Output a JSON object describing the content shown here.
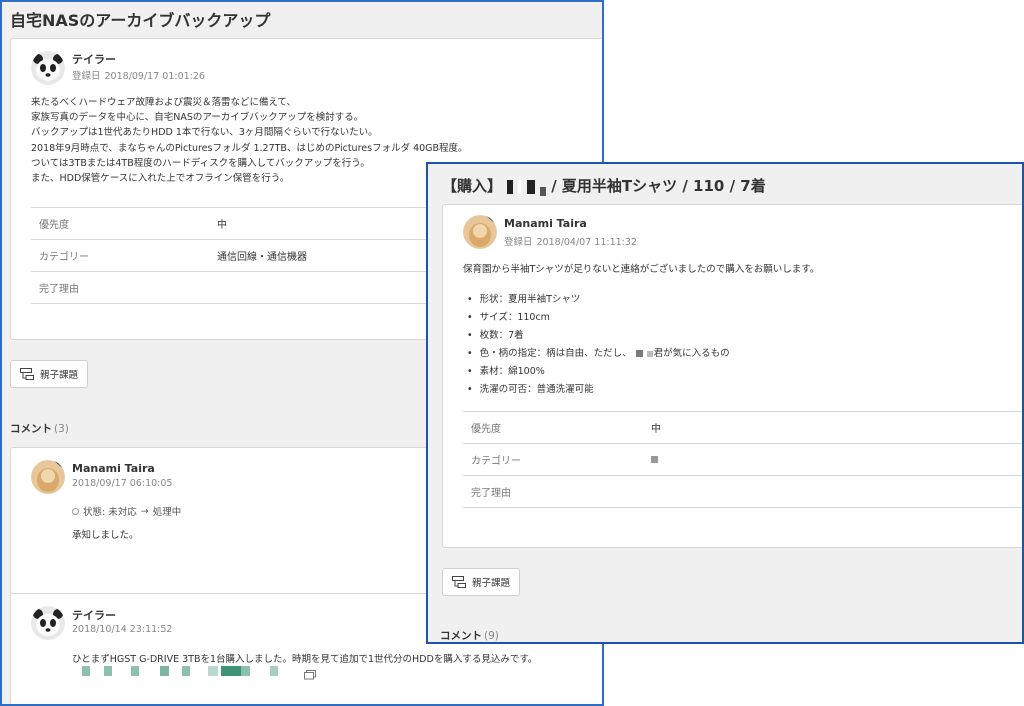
{
  "window_a": {
    "title": "自宅NASのアーカイブバックアップ",
    "issue": {
      "author": "テイラー",
      "created_label": "登録日",
      "created_at": "2018/09/17 01:01:26",
      "description": [
        "来たるべくハードウェア故障および震災＆落雷などに備えて、",
        "家族写真のデータを中心に、自宅NASのアーカイブバックアップを検討する。",
        "バックアップは1世代あたりHDD 1本で行ない、3ヶ月間隔ぐらいで行ないたい。",
        "2018年9月時点で、まなちゃんのPicturesフォルダ 1.27TB、はじめのPicturesフォルダ 40GB程度。",
        "ついては3TBまたは4TB程度のハードディスクを購入してバックアップを行う。",
        "また、HDD保管ケースに入れた上でオフライン保管を行う。"
      ],
      "properties": [
        {
          "key": "優先度",
          "value": "中"
        },
        {
          "key": "カテゴリー",
          "value": "通信回線・通信機器"
        },
        {
          "key": "完了理由",
          "value": ""
        }
      ]
    },
    "parent_child_button": "親子課題",
    "comments_label": "コメント",
    "comments_count": "(3)",
    "comments": [
      {
        "author": "Manami Taira",
        "date": "2018/09/17 06:10:05",
        "status_label": "状態: 未対応",
        "status_arrow": "→",
        "status_to": "処理中",
        "text": "承知しました。"
      },
      {
        "author": "テイラー",
        "date": "2018/10/14 23:11:52",
        "text": "ひとまずHGST G-DRIVE 3TBを1台購入しました。時期を見て追加で1世代分のHDDを購入する見込みです。"
      }
    ]
  },
  "window_b": {
    "title_prefix": "【購入】",
    "title_suffix": "/ 夏用半袖Tシャツ / 110 / 7着",
    "issue": {
      "author": "Manami Taira",
      "created_label": "登録日",
      "created_at": "2018/04/07 11:11:32",
      "intro": "保育園から半袖Tシャツが足りないと連絡がございましたので購入をお願いします。",
      "bullets": [
        "形状：夏用半袖Tシャツ",
        "サイズ：110cm",
        "枚数：7着",
        "色・柄の指定：柄は自由、ただし、",
        "素材：綿100%",
        "洗濯の可否：普通洗濯可能"
      ],
      "bullet_4_tail": "君が気に入るもの",
      "properties": [
        {
          "key": "優先度",
          "value": "中"
        },
        {
          "key": "カテゴリー",
          "value": ""
        },
        {
          "key": "完了理由",
          "value": ""
        }
      ]
    },
    "parent_child_button": "親子課題",
    "comments_label": "コメント",
    "comments_count": "(9)"
  },
  "icons": {
    "panda_avatar": "panda-avatar-icon",
    "photo_avatar": "photo-avatar-icon",
    "parent_child": "parent-child-icon",
    "attachment": "attachment-icon"
  },
  "colors": {
    "window_a_border": "#2e6fc3",
    "window_b_border": "#1d54a8",
    "panel_bg": "#f0f0f0",
    "redaction": "#7a7a7a",
    "pixel_teal": "#6fae98"
  }
}
